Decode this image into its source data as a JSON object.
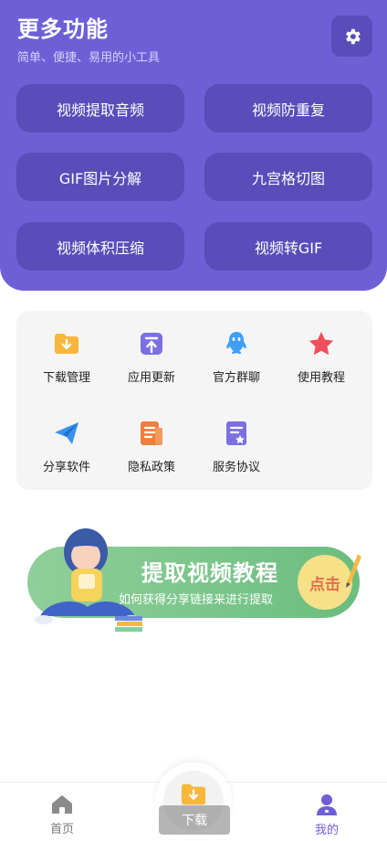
{
  "header": {
    "title": "更多功能",
    "subtitle": "简单、便捷、易用的小工具",
    "accent_color": "#6f5fd7",
    "settings_icon": "gear-icon"
  },
  "tools": [
    {
      "label": "视频提取音频"
    },
    {
      "label": "视频防重复"
    },
    {
      "label": "GIF图片分解"
    },
    {
      "label": "九宫格切图"
    },
    {
      "label": "视频体积压缩"
    },
    {
      "label": "视频转GIF"
    }
  ],
  "grid": [
    {
      "label": "下载管理",
      "icon": "download-folder-icon"
    },
    {
      "label": "应用更新",
      "icon": "update-icon"
    },
    {
      "label": "官方群聊",
      "icon": "qq-icon"
    },
    {
      "label": "使用教程",
      "icon": "star-icon"
    },
    {
      "label": "分享软件",
      "icon": "paper-plane-icon"
    },
    {
      "label": "隐私政策",
      "icon": "document-icon"
    },
    {
      "label": "服务协议",
      "icon": "agreement-icon"
    }
  ],
  "banner": {
    "title": "提取视频教程",
    "subtitle": "如何获得分享链接来进行提取",
    "button": "点击"
  },
  "nav": {
    "home": "首页",
    "download": "下载",
    "mine": "我的"
  }
}
